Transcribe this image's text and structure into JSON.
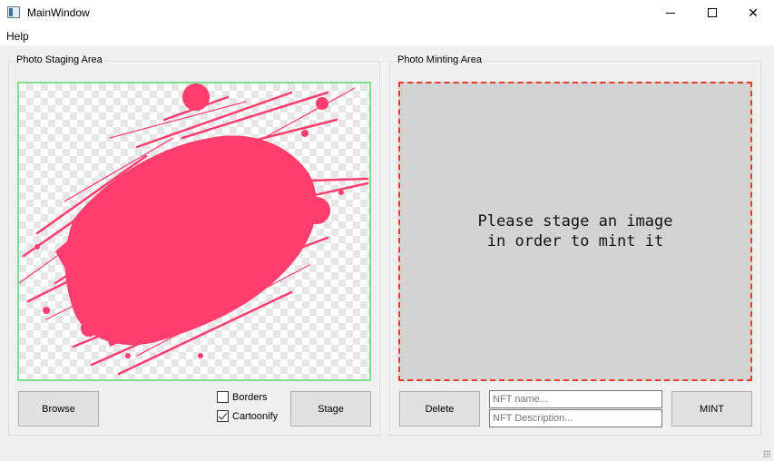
{
  "window": {
    "title": "MainWindow",
    "controls": {
      "minimize": "minimize-icon",
      "maximize": "maximize-icon",
      "close": "close-icon",
      "close_glyph": "✕"
    }
  },
  "menu": {
    "items": [
      {
        "label": "Help"
      }
    ]
  },
  "staging": {
    "group_title": "Photo Staging Area",
    "image": "pink paint splash on transparent checkerboard",
    "browse_label": "Browse",
    "stage_label": "Stage",
    "borders": {
      "label": "Borders",
      "checked": false
    },
    "cartoonify": {
      "label": "Cartoonify",
      "checked": true
    }
  },
  "minting": {
    "group_title": "Photo Minting Area",
    "message": "Please stage an image\nin order to mint it",
    "delete_label": "Delete",
    "mint_label": "MINT",
    "name_placeholder": "NFT name...",
    "description_placeholder": "NFT Description..."
  },
  "colors": {
    "staging_border": "#7ee08f",
    "minting_border": "#e53b2c",
    "splash": "#ff3d6e",
    "minting_bg": "#d3d3d3"
  }
}
